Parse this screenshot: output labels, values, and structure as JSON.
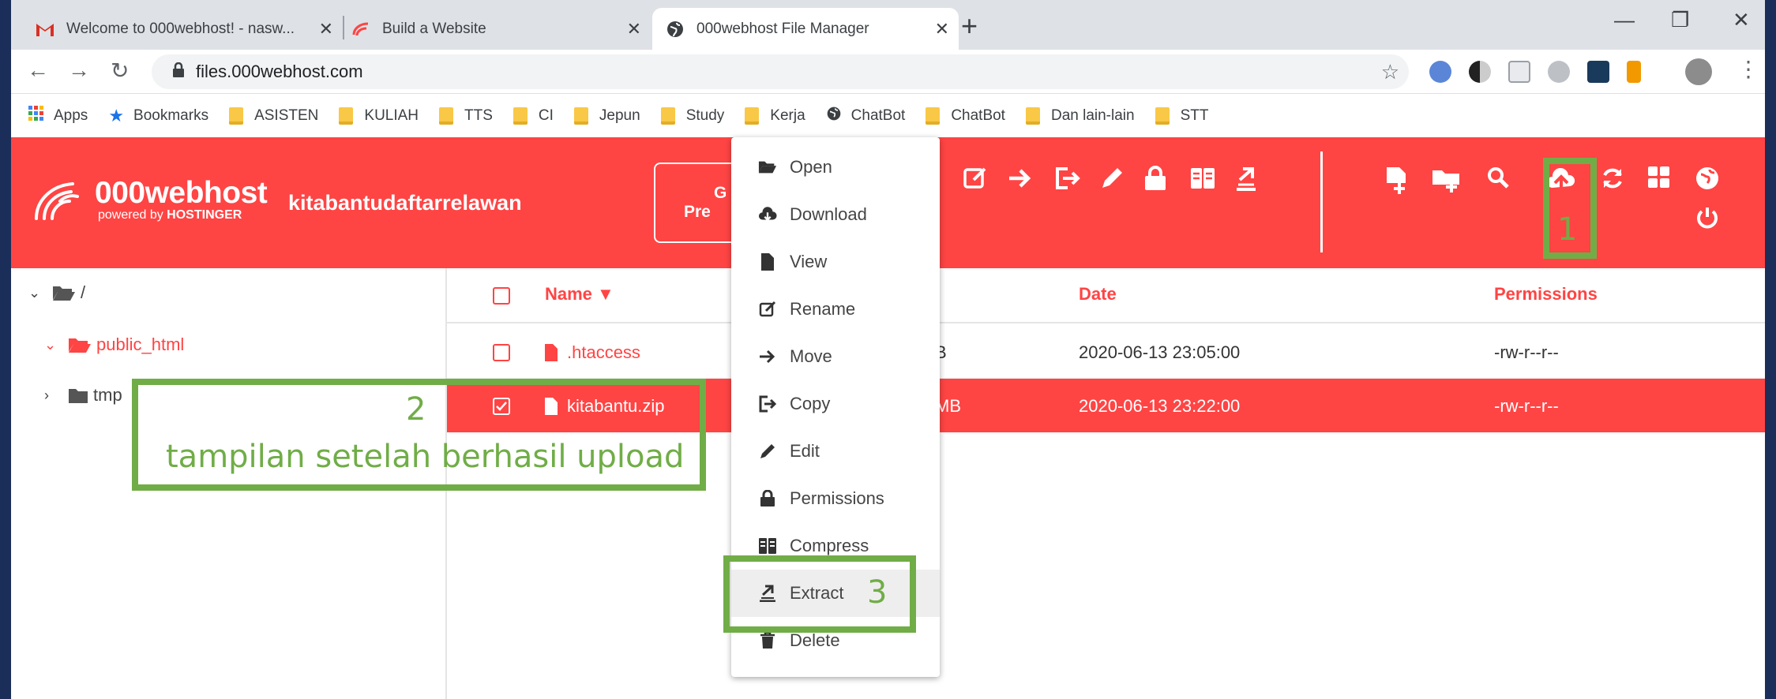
{
  "browser": {
    "tabs": [
      {
        "title": "Welcome to 000webhost! - nasw...",
        "icon": "gmail-icon"
      },
      {
        "title": "Build a Website",
        "icon": "000webhost-icon"
      },
      {
        "title": "000webhost File Manager",
        "icon": "globe-icon"
      }
    ],
    "url": "files.000webhost.com",
    "bookmarks": [
      {
        "label": "Apps",
        "icon": "apps-grid-icon"
      },
      {
        "label": "Bookmarks",
        "icon": "star-icon"
      },
      {
        "label": "ASISTEN",
        "icon": "folder-icon"
      },
      {
        "label": "KULIAH",
        "icon": "folder-icon"
      },
      {
        "label": "TTS",
        "icon": "folder-icon"
      },
      {
        "label": "CI",
        "icon": "folder-icon"
      },
      {
        "label": "Jepun",
        "icon": "folder-icon"
      },
      {
        "label": "Study",
        "icon": "folder-icon"
      },
      {
        "label": "Kerja",
        "icon": "folder-icon"
      },
      {
        "label": "ChatBot",
        "icon": "globe-icon"
      },
      {
        "label": "ChatBot",
        "icon": "folder-icon"
      },
      {
        "label": "Dan lain-lain",
        "icon": "folder-icon"
      },
      {
        "label": "STT",
        "icon": "folder-icon"
      }
    ]
  },
  "header": {
    "brand": "000webhost",
    "brand_sub_prefix": "powered by",
    "brand_sub_name": "HOSTINGER",
    "site_name": "kitabantudaftarrelawan",
    "premium_line1": "G",
    "premium_line2": "Pre"
  },
  "sidebar": {
    "root": "/",
    "items": [
      {
        "label": "public_html",
        "expanded": true
      },
      {
        "label": "tmp",
        "expanded": false
      }
    ]
  },
  "file_list": {
    "columns": {
      "name": "Name ▼",
      "date": "Date",
      "permissions": "Permissions"
    },
    "rows": [
      {
        "name": ".htaccess",
        "size": "B",
        "date": "2020-06-13 23:05:00",
        "permissions": "-rw-r--r--",
        "selected": false
      },
      {
        "name": "kitabantu.zip",
        "size": "MB",
        "date": "2020-06-13 23:22:00",
        "permissions": "-rw-r--r--",
        "selected": true
      }
    ]
  },
  "context_menu": {
    "items": [
      {
        "label": "Open",
        "icon": "folder-open-icon"
      },
      {
        "label": "Download",
        "icon": "cloud-download-icon"
      },
      {
        "label": "View",
        "icon": "file-icon"
      },
      {
        "label": "Rename",
        "icon": "edit-square-icon"
      },
      {
        "label": "Move",
        "icon": "arrow-right-icon"
      },
      {
        "label": "Copy",
        "icon": "copy-sign-out-icon"
      },
      {
        "label": "Edit",
        "icon": "pencil-icon"
      },
      {
        "label": "Permissions",
        "icon": "lock-icon"
      },
      {
        "label": "Compress",
        "icon": "archive-icon"
      },
      {
        "label": "Extract",
        "icon": "extract-icon"
      },
      {
        "label": "Delete",
        "icon": "trash-icon"
      }
    ]
  },
  "annotations": {
    "n1": "1",
    "n2": "2",
    "n3": "3",
    "caption": "tampilan setelah berhasil upload",
    "color": "#70ad47"
  },
  "colors": {
    "brand_red": "#ff4444",
    "annotation_green": "#70ad47"
  }
}
